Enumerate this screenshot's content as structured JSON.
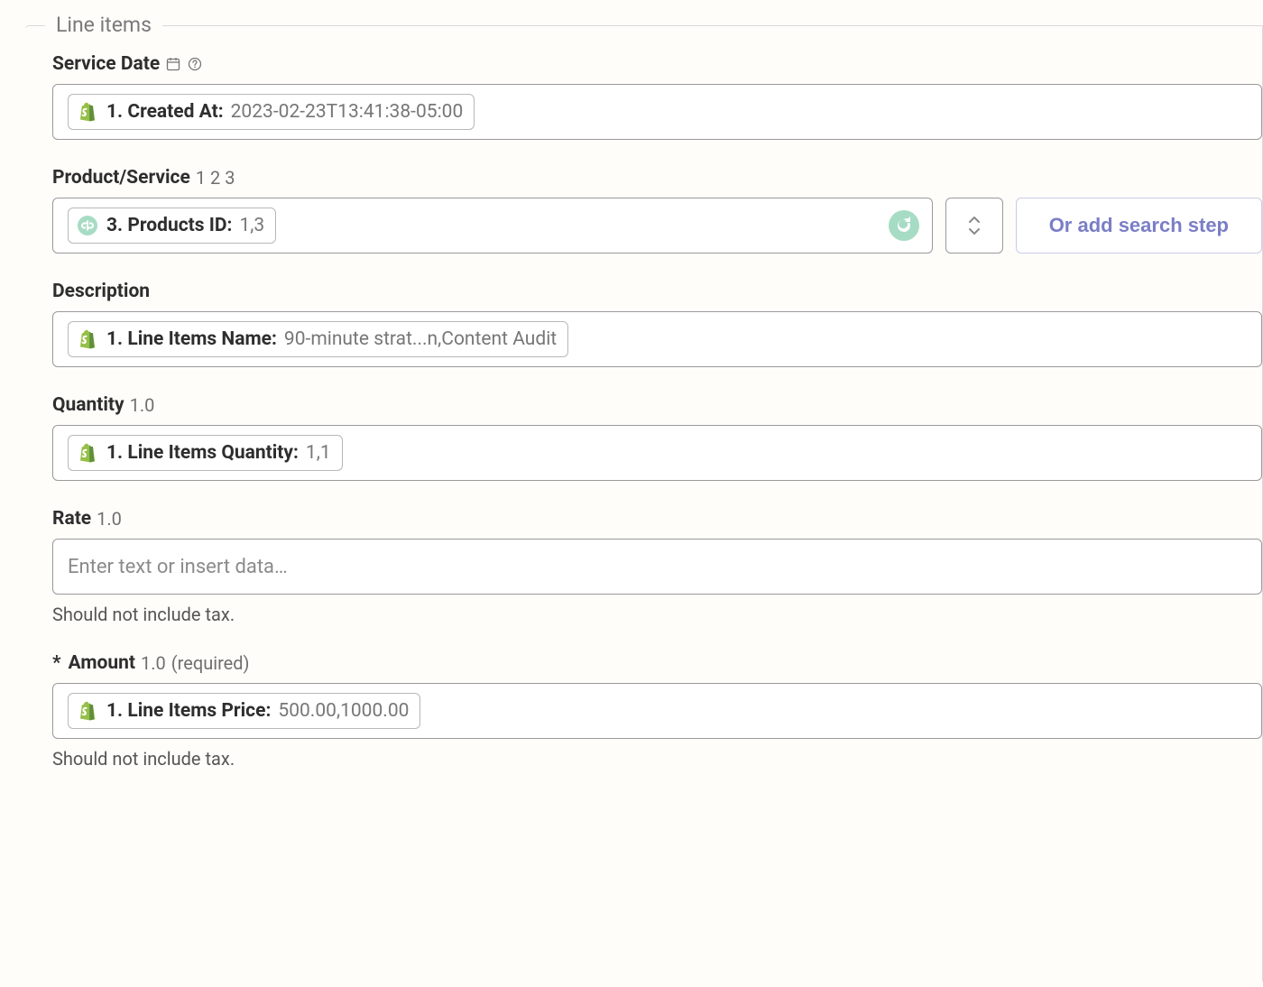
{
  "section": {
    "title": "Line items"
  },
  "fields": {
    "service_date": {
      "label": "Service Date",
      "pill": {
        "icon": "shopify",
        "label": "1. Created At:",
        "value": "2023-02-23T13:41:38-05:00"
      }
    },
    "product_service": {
      "label": "Product/Service",
      "sub": "1 2 3",
      "pill": {
        "icon": "quickbooks",
        "label": "3. Products ID:",
        "value": "1,3"
      },
      "search_btn": "Or add search step"
    },
    "description": {
      "label": "Description",
      "pill": {
        "icon": "shopify",
        "label": "1. Line Items Name:",
        "value": "90-minute strat...n,Content Audit"
      }
    },
    "quantity": {
      "label": "Quantity",
      "sub": "1.0",
      "pill": {
        "icon": "shopify",
        "label": "1. Line Items Quantity:",
        "value": "1,1"
      }
    },
    "rate": {
      "label": "Rate",
      "sub": "1.0",
      "placeholder": "Enter text or insert data…",
      "help": "Should not include tax."
    },
    "amount": {
      "prefix": "*",
      "label": "Amount",
      "sub": "1.0",
      "required": "(required)",
      "pill": {
        "icon": "shopify",
        "label": "1. Line Items Price:",
        "value": "500.00,1000.00"
      },
      "help": "Should not include tax."
    }
  }
}
